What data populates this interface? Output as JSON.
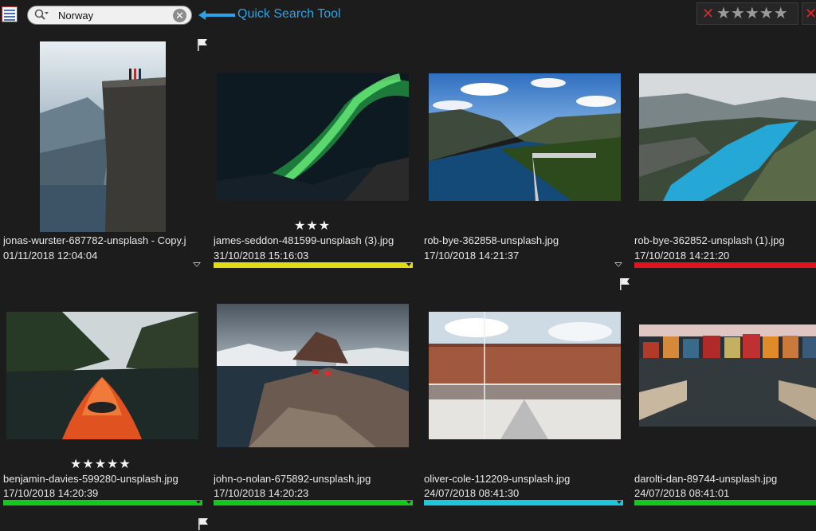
{
  "toolbar": {
    "search_value": "Norway",
    "callout_label": "Quick Search Tool",
    "rating_filter_x": "✕",
    "rating_filter_stars": "★★★★★",
    "rating_filter_x2": "✕"
  },
  "colors": {
    "yellow": "#e0dc17",
    "red": "#e0141e",
    "green": "#16c81e",
    "cyan": "#1ec8dc",
    "accent": "#2aa4e6"
  },
  "thumbnails": [
    {
      "filename": "jonas-wurster-687782-unsplash - Copy.j",
      "date": "01/11/2018 12:04:04",
      "rating": "",
      "label_color": "",
      "flag": true
    },
    {
      "filename": "james-seddon-481599-unsplash (3).jpg",
      "date": "31/10/2018 15:16:03",
      "rating": "★★★",
      "label_color": "yellow",
      "flag": false
    },
    {
      "filename": "rob-bye-362858-unsplash.jpg",
      "date": "17/10/2018 14:21:37",
      "rating": "",
      "label_color": "",
      "flag": false
    },
    {
      "filename": "rob-bye-362852-unsplash (1).jpg",
      "date": "17/10/2018 14:21:20",
      "rating": "",
      "label_color": "red",
      "flag": true
    },
    {
      "filename": "benjamin-davies-599280-unsplash.jpg",
      "date": "17/10/2018 14:20:39",
      "rating": "★★★★★",
      "label_color": "green",
      "flag": false
    },
    {
      "filename": "john-o-nolan-675892-unsplash.jpg",
      "date": "17/10/2018 14:20:23",
      "rating": "",
      "label_color": "green",
      "flag": true
    },
    {
      "filename": "oliver-cole-112209-unsplash.jpg",
      "date": "24/07/2018 08:41:30",
      "rating": "",
      "label_color": "cyan",
      "flag": false
    },
    {
      "filename": "darolti-dan-89744-unsplash.jpg",
      "date": "24/07/2018 08:41:01",
      "rating": "",
      "label_color": "green",
      "flag": false
    }
  ]
}
